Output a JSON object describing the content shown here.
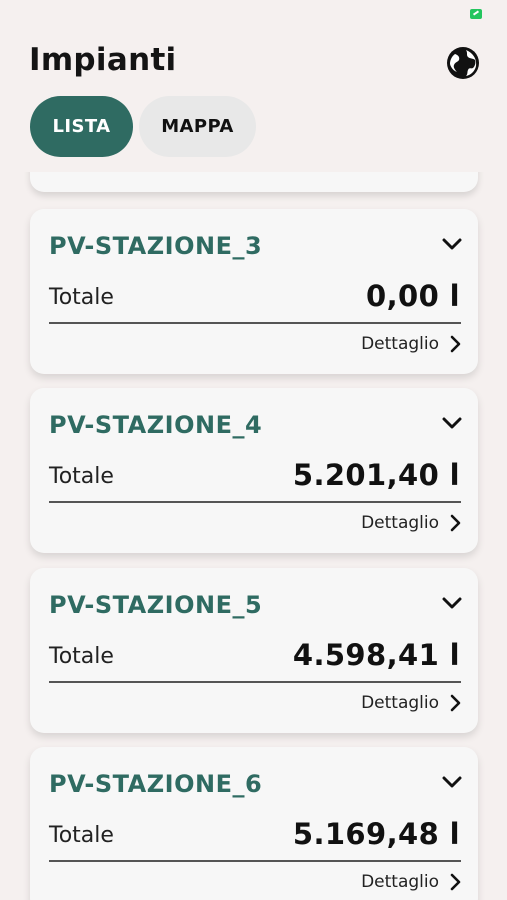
{
  "header": {
    "title": "Impianti"
  },
  "tabs": [
    {
      "label": "LISTA",
      "active": true
    },
    {
      "label": "MAPPA",
      "active": false
    }
  ],
  "stations": [
    {
      "name": "PV-STAZIONE_3",
      "total_label": "Totale",
      "total_value": "0,00 l",
      "detail_label": "Dettaglio"
    },
    {
      "name": "PV-STAZIONE_4",
      "total_label": "Totale",
      "total_value": "5.201,40 l",
      "detail_label": "Dettaglio"
    },
    {
      "name": "PV-STAZIONE_5",
      "total_label": "Totale",
      "total_value": "4.598,41 l",
      "detail_label": "Dettaglio"
    },
    {
      "name": "PV-STAZIONE_6",
      "total_label": "Totale",
      "total_value": "5.169,48 l",
      "detail_label": "Dettaglio"
    }
  ],
  "icons": {
    "globe": "globe-icon",
    "expand": "chevron-down-icon",
    "detail": "chevron-right-icon"
  },
  "colors": {
    "accent": "#2f6b62",
    "background": "#f5f0ef",
    "card": "#f7f7f7",
    "inactive_tab": "#e8e8e8"
  }
}
